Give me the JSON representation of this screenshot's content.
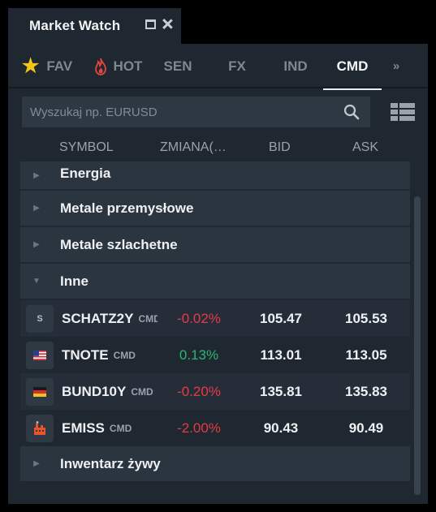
{
  "window": {
    "title": "Market Watch"
  },
  "tabs": [
    {
      "label": "FAV",
      "icon": "star-icon",
      "active": false
    },
    {
      "label": "HOT",
      "icon": "flame-icon",
      "active": false
    },
    {
      "label": "SEN"
    },
    {
      "label": "FX"
    },
    {
      "label": "IND"
    },
    {
      "label": "CMD",
      "active": true
    },
    {
      "label": "»"
    }
  ],
  "search": {
    "placeholder": "Wyszukaj np. EURUSD"
  },
  "columns": {
    "symbol": "SYMBOL",
    "change": "ZMIANA(…",
    "bid": "BID",
    "ask": "ASK"
  },
  "groups": [
    {
      "label": "Energia",
      "expanded": false
    },
    {
      "label": "Metale przemysłowe",
      "expanded": false
    },
    {
      "label": "Metale szlachetne",
      "expanded": false
    },
    {
      "label": "Inne",
      "expanded": true
    },
    {
      "label": "Inwentarz żywy",
      "expanded": false
    }
  ],
  "items": [
    {
      "symbol": "SCHATZ2Y",
      "type": "CMD",
      "change": "-0.02%",
      "bid": "105.47",
      "ask": "105.53",
      "icon": "S"
    },
    {
      "symbol": "TNOTE",
      "type": "CMD",
      "change": "0.13%",
      "bid": "113.01",
      "ask": "113.05",
      "icon": "us-flag-icon"
    },
    {
      "symbol": "BUND10Y",
      "type": "CMD",
      "change": "-0.20%",
      "bid": "135.81",
      "ask": "135.83",
      "icon": "de-flag-icon"
    },
    {
      "symbol": "EMISS",
      "type": "CMD",
      "change": "-2.00%",
      "bid": "90.43",
      "ask": "90.49",
      "icon": "factory-icon"
    }
  ],
  "colors": {
    "negative": "#e63a45",
    "positive": "#2bb673",
    "star": "#f5c518",
    "flame": "#e8453c"
  }
}
